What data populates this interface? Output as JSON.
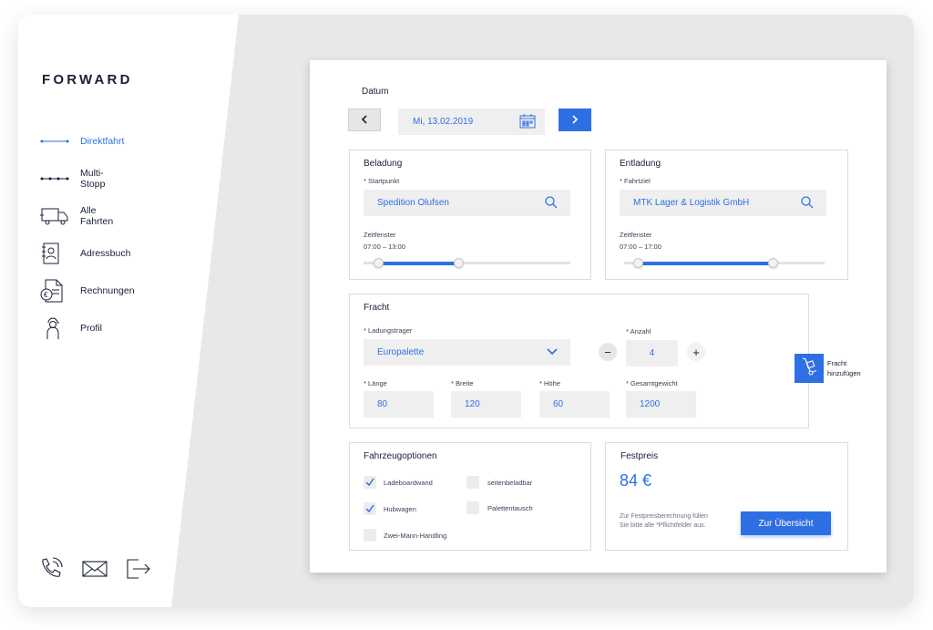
{
  "brand": {
    "logo": "FORWARD"
  },
  "nav": {
    "items": [
      {
        "label": "Direktfahrt",
        "icon": "direct-route-icon",
        "active": true
      },
      {
        "label": "Multi-Stopp",
        "icon": "multi-stop-icon",
        "active": false
      },
      {
        "label": "Alle Fahrten",
        "icon": "truck-icon",
        "active": false
      },
      {
        "label": "Adressbuch",
        "icon": "address-book-icon",
        "active": false
      },
      {
        "label": "Rechnungen",
        "icon": "invoice-icon",
        "active": false
      },
      {
        "label": "Profil",
        "icon": "profile-icon",
        "active": false
      }
    ]
  },
  "footer": {
    "icons": [
      "phone-icon",
      "mail-icon",
      "logout-icon"
    ]
  },
  "date": {
    "label": "Datum",
    "value": "Mi, 13.02.2019"
  },
  "loading": {
    "title": "Beladung",
    "start_label": "* Startpunkt",
    "start_value": "Spedition Olufsen",
    "window_label": "Zeitfenster",
    "window_value": "07:00 – 13:00",
    "slider_from": 0.07,
    "slider_to": 0.46
  },
  "unloading": {
    "title": "Entladung",
    "dest_label": "* Fahrtziel",
    "dest_value": "MTK Lager & Logistik GmbH",
    "window_label": "Zeitfenster",
    "window_value": "07:00 – 17:00",
    "slider_from": 0.07,
    "slider_to": 0.74
  },
  "freight": {
    "title": "Fracht",
    "carrier_label": "* Ladungstrager",
    "carrier_value": "Europalette",
    "count_label": "* Anzahl",
    "count_value": "4",
    "length_label": "* Länge",
    "length_value": "80",
    "width_label": "* Breite",
    "width_value": "120",
    "height_label": "* Höhe",
    "height_value": "60",
    "weight_label": "* Gesamtgewicht",
    "weight_value": "1200",
    "add_label_1": "Fracht",
    "add_label_2": "hinzufügen"
  },
  "vehicle": {
    "title": "Fahrzeugoptionen",
    "options": [
      {
        "label": "Ladeboardwand",
        "checked": true
      },
      {
        "label": "seitenbeladbar",
        "checked": false
      },
      {
        "label": "Hubwagen",
        "checked": true
      },
      {
        "label": "Palettentausch",
        "checked": false
      },
      {
        "label": "Zwei-Mann-Handling",
        "checked": false
      }
    ]
  },
  "price": {
    "title": "Festpreis",
    "value": "84 €",
    "hint_1": "Zur Festpreisberechnung füllen",
    "hint_2": "Sie bitte alle *Pflichtfelder aus.",
    "button": "Zur Übersicht"
  },
  "colors": {
    "accent": "#2f6fe4",
    "text": "#1a1f36",
    "field": "#efefef"
  }
}
